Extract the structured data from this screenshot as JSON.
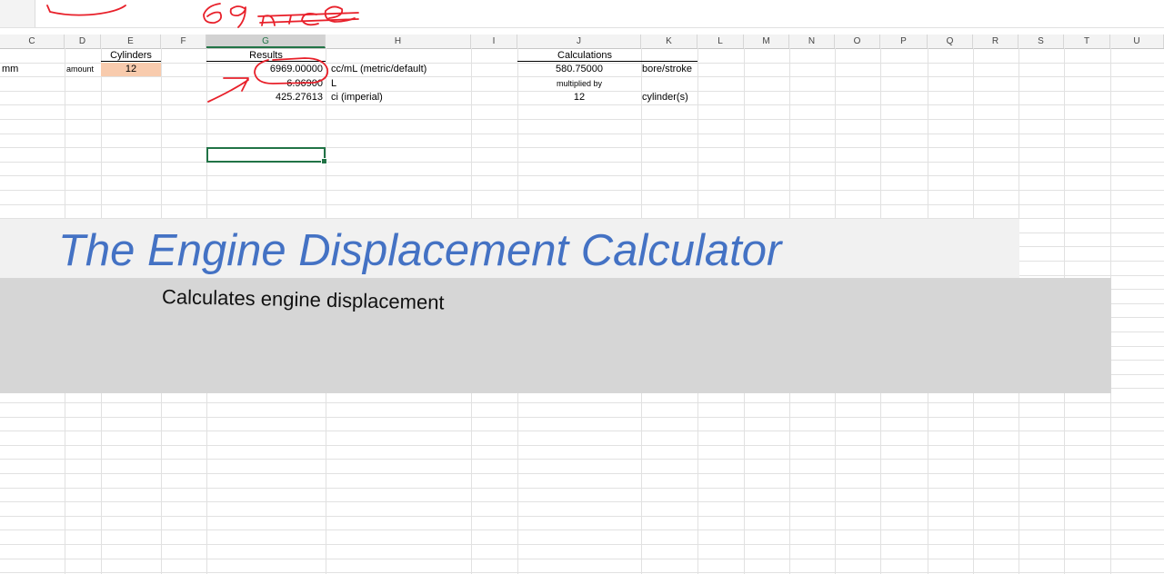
{
  "sheet": {
    "columns": [
      "C",
      "D",
      "E",
      "F",
      "G",
      "H",
      "I",
      "J",
      "K",
      "L",
      "M",
      "N",
      "O",
      "P",
      "Q",
      "R",
      "S",
      "T",
      "U"
    ],
    "active_column": "G",
    "header_row": {
      "cylinders": "Cylinders",
      "results": "Results",
      "calculations": "Calculations"
    },
    "row_mm": {
      "unit": "mm",
      "amount_label": "amount",
      "cylinders_value": "12",
      "cc_result": "6969.00000",
      "cc_label": "cc/mL (metric/default)",
      "calc_value": "580.75000",
      "calc_label": "bore/stroke"
    },
    "row_l": {
      "l_result": "6.96900",
      "l_label": "L",
      "calc_note": "multiplied by"
    },
    "row_ci": {
      "ci_result": "425.27613",
      "ci_label": "ci (imperial)",
      "calc_value": "12",
      "calc_label": "cylinder(s)"
    }
  },
  "banner": {
    "title": "The Engine Displacement Calculator",
    "subtitle": "Calculates engine displacement"
  },
  "annotation": {
    "ink_text": "69 nice",
    "ink_color": "#e8202a"
  },
  "colors": {
    "accent_green": "#217346",
    "title_blue": "#4472c4",
    "input_fill": "#f8cbad"
  }
}
